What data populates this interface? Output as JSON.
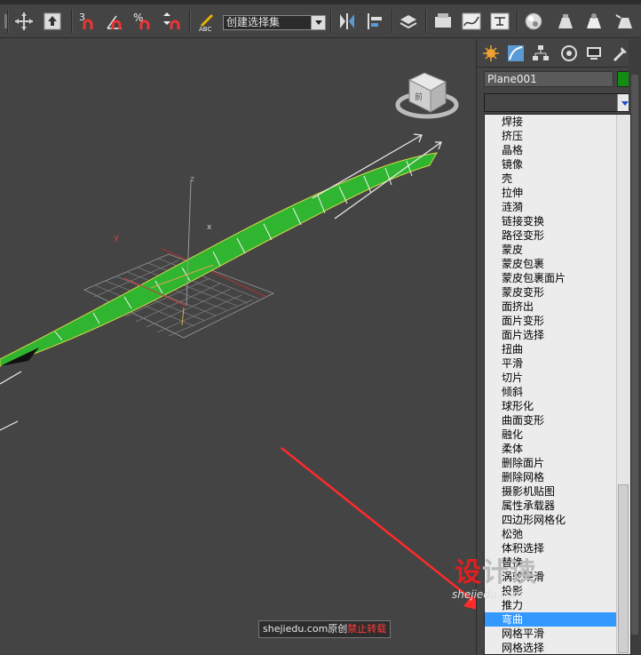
{
  "toolbar": {
    "selection_set": "创建选择集",
    "snap_numbers": [
      "3",
      "%"
    ]
  },
  "viewport": {
    "viewcube_label": "前",
    "axis_x": "x",
    "axis_y": "y",
    "axis_z": "z"
  },
  "panel": {
    "object_name": "Plane001",
    "object_color": "#138c13",
    "modifier_list": [
      "焊接",
      "挤压",
      "晶格",
      "镜像",
      "壳",
      "拉伸",
      "涟漪",
      "链接变换",
      "路径变形",
      "蒙皮",
      "蒙皮包裹",
      "蒙皮包裹面片",
      "蒙皮变形",
      "面挤出",
      "面片变形",
      "面片选择",
      "扭曲",
      "平滑",
      "切片",
      "倾斜",
      "球形化",
      "曲面变形",
      "融化",
      "柔体",
      "删除面片",
      "删除网格",
      "摄影机贴图",
      "属性承载器",
      "四边形网格化",
      "松弛",
      "体积选择",
      "替换",
      "涡轮平滑",
      "投影",
      "推力",
      "弯曲",
      "网格平滑",
      "网格选择"
    ],
    "selected_modifier": "弯曲",
    "selected_index": 35
  },
  "watermark": {
    "site_text": "shejiedu.com原创",
    "warning_text": "禁止转载",
    "logo_red": "设",
    "logo_rest": "计读",
    "logo_url": "shejiedu.com"
  },
  "colors": {
    "plane_fill": "#2fb52f",
    "selection_highlight": "#3399ff",
    "arrow": "#ff2a2a"
  }
}
